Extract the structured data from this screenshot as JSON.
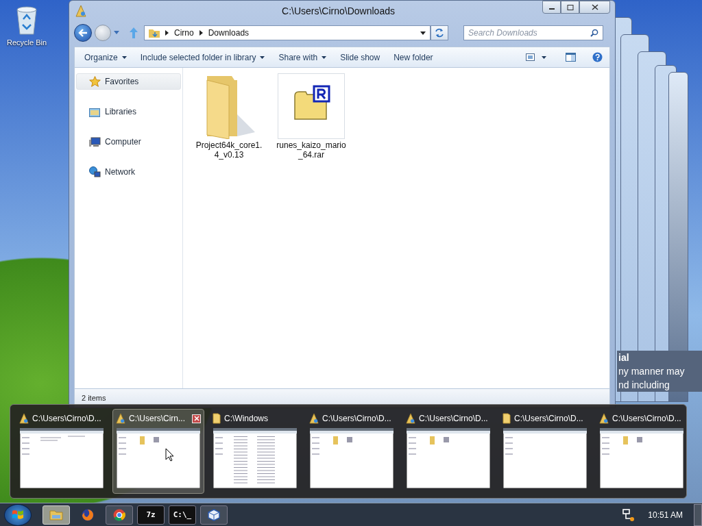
{
  "desktop": {
    "icons": [
      {
        "label": "Recycle Bin",
        "kind": "recycle"
      }
    ],
    "background_text": [
      "ial",
      "ny manner may",
      "nd including"
    ]
  },
  "window": {
    "title": "C:\\Users\\Cirno\\Downloads",
    "breadcrumb": [
      "Cirno",
      "Downloads"
    ],
    "search": {
      "placeholder": "Search Downloads"
    },
    "toolbar": [
      {
        "label": "Organize",
        "dropdown": true
      },
      {
        "label": "Include selected folder in library",
        "dropdown": true
      },
      {
        "label": "Share with",
        "dropdown": true
      },
      {
        "label": "Slide show",
        "dropdown": false
      },
      {
        "label": "New folder",
        "dropdown": false
      }
    ],
    "sidebar": {
      "items": [
        {
          "label": "Favorites",
          "kind": "star",
          "selected": true
        },
        {
          "label": "Libraries",
          "kind": "libraries",
          "selected": false
        },
        {
          "label": "Computer",
          "kind": "computer",
          "selected": false
        },
        {
          "label": "Network",
          "kind": "network",
          "selected": false
        }
      ]
    },
    "files": [
      {
        "name": "Project64k_core1.4_v0.13",
        "kind": "folder",
        "selected": false
      },
      {
        "name": "runes_kaizo_mario_64.rar",
        "kind": "archive",
        "selected": true
      }
    ],
    "status_bar": {
      "count": "2 items"
    }
  },
  "thumbnails": [
    {
      "title": "C:\\Users\\Cirno\\D...",
      "kind": "explorer",
      "preview": {
        "kind": "details"
      },
      "selected": false
    },
    {
      "title": "C:\\Users\\Cirn...",
      "kind": "explorer",
      "preview": {
        "kind": "files"
      },
      "selected": true
    },
    {
      "title": "C:\\Windows",
      "kind": "folder",
      "preview": {
        "kind": "list"
      },
      "selected": false
    },
    {
      "title": "C:\\Users\\Cirno\\D...",
      "kind": "explorer",
      "preview": {
        "kind": "files"
      },
      "selected": false
    },
    {
      "title": "C:\\Users\\Cirno\\D...",
      "kind": "explorer",
      "preview": {
        "kind": "files"
      },
      "selected": false
    },
    {
      "title": "C:\\Users\\Cirno\\D...",
      "kind": "folder",
      "preview": {
        "kind": "empty"
      },
      "selected": false
    },
    {
      "title": "C:\\Users\\Cirno\\D...",
      "kind": "explorer",
      "preview": {
        "kind": "files"
      },
      "selected": false
    }
  ],
  "taskbar": {
    "items": [
      {
        "kind": "explorer",
        "running": true,
        "active": true
      },
      {
        "kind": "firefox",
        "running": false,
        "active": false
      },
      {
        "kind": "chrome",
        "running": true,
        "active": false
      },
      {
        "kind": "sevenzip",
        "label": "7z",
        "running": true,
        "active": false
      },
      {
        "kind": "cmd",
        "label": "C:\\_",
        "running": true,
        "active": false
      },
      {
        "kind": "virtualbox",
        "running": true,
        "active": false
      }
    ],
    "clock": "10:51 AM"
  }
}
